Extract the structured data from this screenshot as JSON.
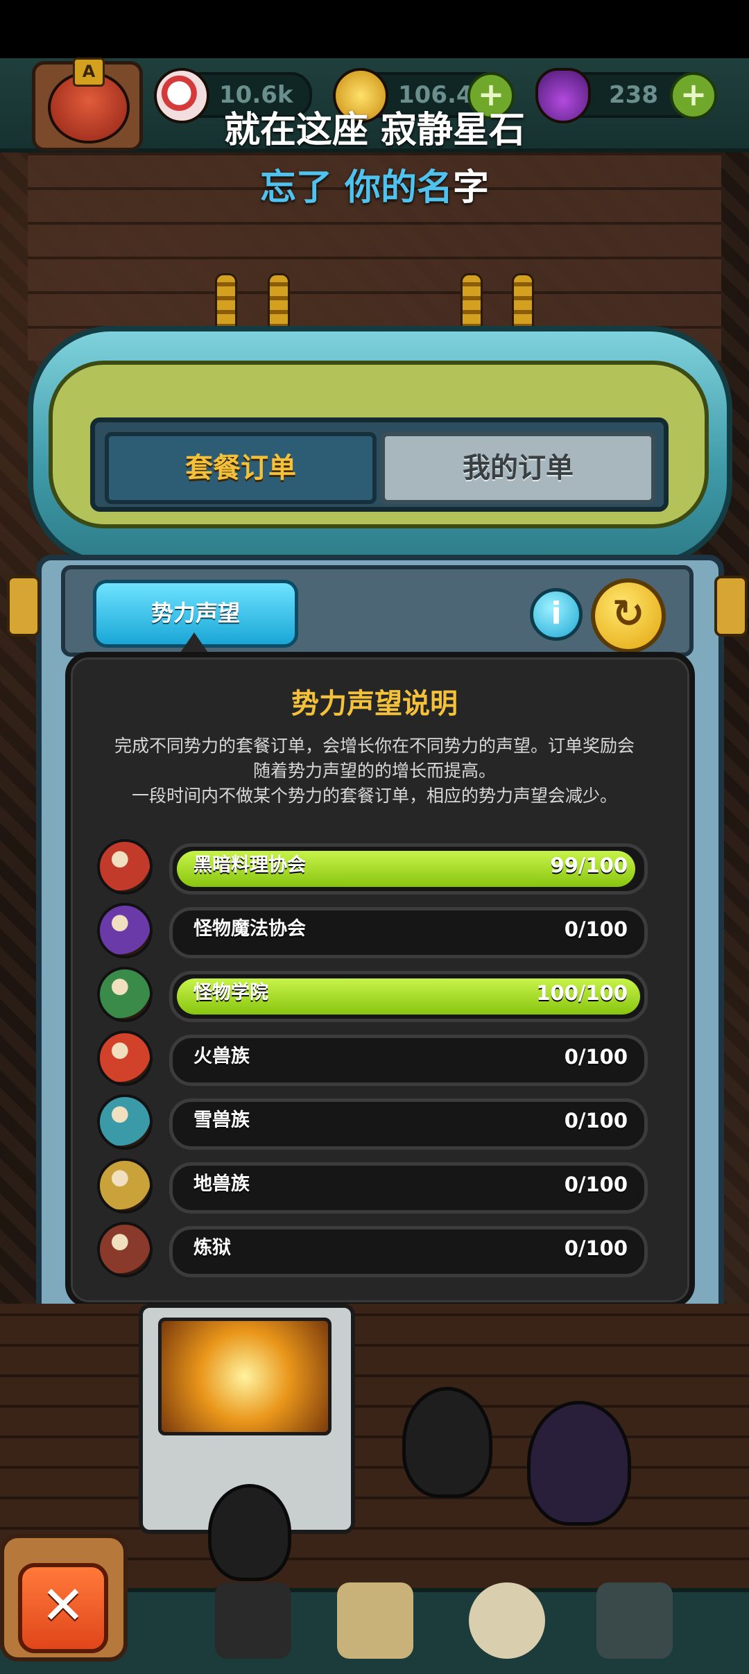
{
  "hud": {
    "avatar_badge": "A",
    "eyeball_value": "10.6k",
    "coin_value": "106.4m",
    "potion_value": "238",
    "plus_label": "+"
  },
  "lyrics": {
    "line1": "就在这座 寂静星石",
    "line2_part1": "忘了 你的名",
    "line2_part2": "字"
  },
  "tabs": {
    "set_orders": "套餐订单",
    "my_orders": "我的订单"
  },
  "subtab": {
    "label": "势力声望"
  },
  "buttons": {
    "info": "i",
    "refresh": "↻",
    "close": "✕"
  },
  "popup": {
    "title": "势力声望说明",
    "desc_line1": "完成不同势力的套餐订单，会增长你在不同势力的声望。订单奖励会",
    "desc_line2": "随着势力声望的的增长而提高。",
    "desc_line3": "一段时间内不做某个势力的套餐订单，相应的势力声望会减少。"
  },
  "reputation": [
    {
      "name": "黑暗料理协会",
      "value": "99/100",
      "fraction": 0.99,
      "icon": "dark-cuisine-guild-icon",
      "color": "#c23a2a"
    },
    {
      "name": "怪物魔法协会",
      "value": "0/100",
      "fraction": 0.0,
      "icon": "monster-magic-guild-icon",
      "color": "#6a3aa8"
    },
    {
      "name": "怪物学院",
      "value": "100/100",
      "fraction": 1.0,
      "icon": "monster-academy-icon",
      "color": "#3a8a4a"
    },
    {
      "name": "火兽族",
      "value": "0/100",
      "fraction": 0.0,
      "icon": "fire-beast-clan-icon",
      "color": "#d2412a"
    },
    {
      "name": "雪兽族",
      "value": "0/100",
      "fraction": 0.0,
      "icon": "snow-beast-clan-icon",
      "color": "#3a9aa8"
    },
    {
      "name": "地兽族",
      "value": "0/100",
      "fraction": 0.0,
      "icon": "earth-beast-clan-icon",
      "color": "#c9a23a"
    },
    {
      "name": "炼狱",
      "value": "0/100",
      "fraction": 0.0,
      "icon": "purgatory-icon",
      "color": "#8a3a2a"
    }
  ],
  "colors": {
    "accent_gold": "#f4c23a",
    "bar_fill": "#a6dc2a",
    "subtab_blue": "#1aa6d6"
  }
}
